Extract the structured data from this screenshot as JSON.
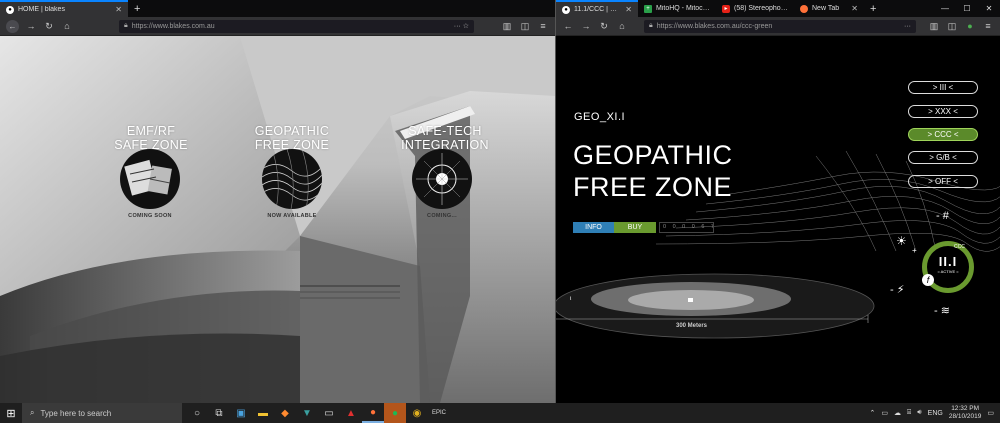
{
  "left_window": {
    "tab": {
      "title": "HOME | blakes"
    },
    "url": "https://www.blakes.com.au",
    "zones": [
      {
        "title_line1": "EMF/RF",
        "title_line2": "SAFE ZONE",
        "status": "COMING SOON"
      },
      {
        "title_line1": "GEOPATHIC",
        "title_line2": "FREE ZONE",
        "status": "NOW AVAILABLE"
      },
      {
        "title_line1": "SAFE-TECH",
        "title_line2": "INTEGRATION",
        "status": "COMING..."
      }
    ]
  },
  "right_window": {
    "tabs": [
      {
        "title": "11.1/CCC | blakes",
        "active": true
      },
      {
        "title": "MitoHQ - Mitoch...",
        "active": false
      },
      {
        "title": "(58) Stereophonic...",
        "active": false
      },
      {
        "title": "New Tab",
        "active": false
      }
    ],
    "url": "https://www.blakes.com.au/ccc-green",
    "geo_code": "GEO_XI.I",
    "title_line1": "GEOPATHIC",
    "title_line2": "FREE ZONE",
    "info_label": "INFO",
    "buy_label": "BUY",
    "counter": "0 0 0 0 6 7 3",
    "menu": [
      {
        "label": "> III <",
        "active": false
      },
      {
        "label": "> XXX <",
        "active": false
      },
      {
        "label": "> CCC <",
        "active": true
      },
      {
        "label": "> G/B <",
        "active": false
      },
      {
        "label": "> OFF <",
        "active": false
      }
    ],
    "scale_label": "300 Meters",
    "badge": {
      "value": "II.I",
      "sub": "= ACTIVE =",
      "tag": "CCC"
    },
    "accent_color": "#6a9a2f"
  },
  "taskbar": {
    "search_placeholder": "Type here to search",
    "language": "ENG",
    "time": "12:32 PM",
    "date": "28/10/2019"
  }
}
